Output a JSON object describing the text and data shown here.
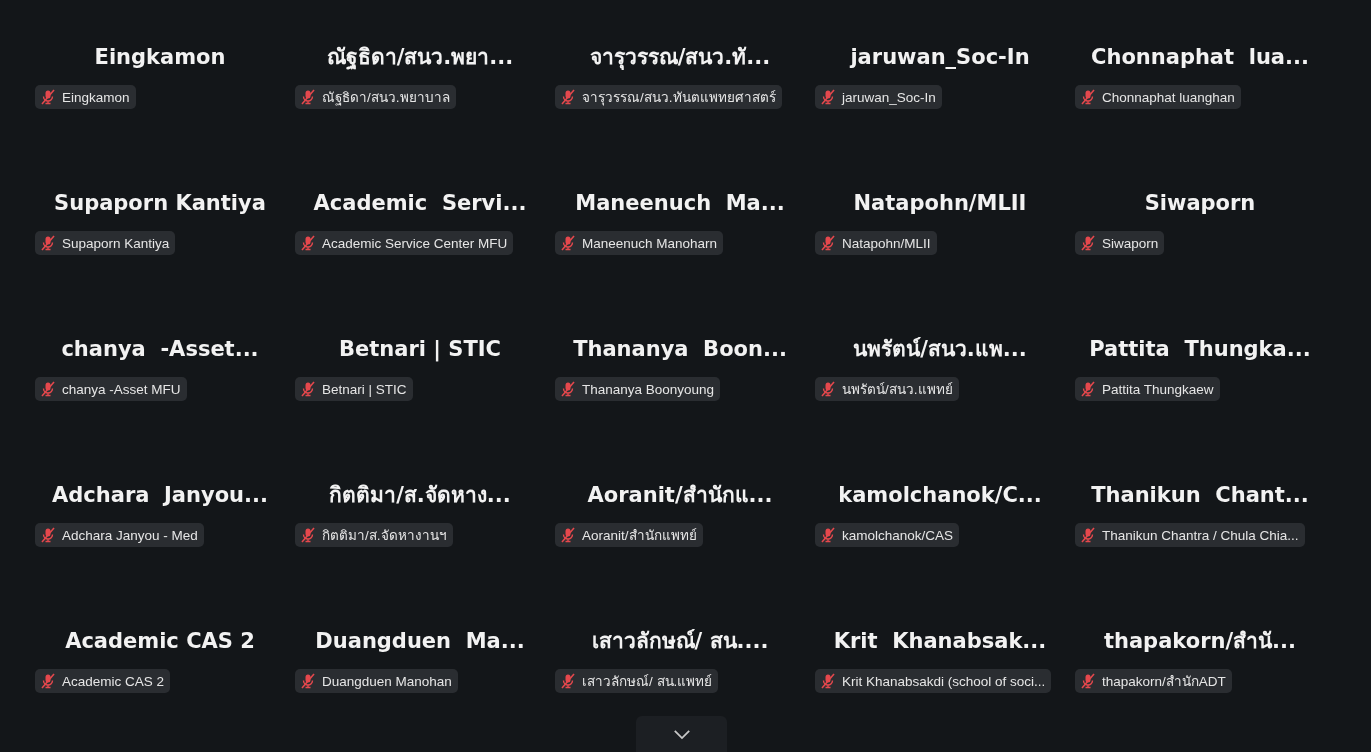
{
  "tiles": [
    {
      "display_name": "Eingkamon",
      "label": "Eingkamon",
      "muted": true
    },
    {
      "display_name": "ณัฐธิดา/สนว.พยา...",
      "label": "ณัฐธิดา/สนว.พยาบาล",
      "muted": true
    },
    {
      "display_name": "จารุวรรณ/สนว.ทั...",
      "label": "จารุวรรณ/สนว.ทันตแพทยศาสตร์",
      "muted": true
    },
    {
      "display_name": "jaruwan_Soc-In",
      "label": "jaruwan_Soc-In",
      "muted": true
    },
    {
      "display_name": "Chonnaphat  lua...",
      "label": "Chonnaphat luanghan",
      "muted": true
    },
    {
      "display_name": "Supaporn Kantiya",
      "label": "Supaporn Kantiya",
      "muted": true
    },
    {
      "display_name": "Academic  Servi...",
      "label": "Academic Service Center MFU",
      "muted": true
    },
    {
      "display_name": "Maneenuch  Ma...",
      "label": "Maneenuch Manoharn",
      "muted": true
    },
    {
      "display_name": "Natapohn/MLII",
      "label": "Natapohn/MLII",
      "muted": true
    },
    {
      "display_name": "Siwaporn",
      "label": "Siwaporn",
      "muted": true
    },
    {
      "display_name": "chanya  -Asset...",
      "label": "chanya -Asset MFU",
      "muted": true
    },
    {
      "display_name": "Betnari | STIC",
      "label": "Betnari | STIC",
      "muted": true
    },
    {
      "display_name": "Thananya  Boon...",
      "label": "Thananya Boonyoung",
      "muted": true
    },
    {
      "display_name": "นพรัตน์/สนว.แพ...",
      "label": "นพรัตน์/สนว.แพทย์",
      "muted": true
    },
    {
      "display_name": "Pattita  Thungka...",
      "label": "Pattita Thungkaew",
      "muted": true
    },
    {
      "display_name": "Adchara  Janyou...",
      "label": "Adchara Janyou - Med",
      "muted": true
    },
    {
      "display_name": "กิตติมา/ส.จัดหาง...",
      "label": "กิตติมา/ส.จัดหางานฯ",
      "muted": true
    },
    {
      "display_name": "Aoranit/สำนักแ...",
      "label": "Aoranit/สำนักแพทย์",
      "muted": true
    },
    {
      "display_name": "kamolchanok/C...",
      "label": "kamolchanok/CAS",
      "muted": true
    },
    {
      "display_name": "Thanikun  Chant...",
      "label": "Thanikun Chantra / Chula Chia...",
      "muted": true
    },
    {
      "display_name": "Academic CAS 2",
      "label": "Academic CAS 2",
      "muted": true
    },
    {
      "display_name": "Duangduen  Ma...",
      "label": "Duangduen Manohan",
      "muted": true
    },
    {
      "display_name": "เสาวลักษณ์/ สน....",
      "label": "เสาวลักษณ์/ สน.แพทย์",
      "muted": true
    },
    {
      "display_name": "Krit  Khanabsak...",
      "label": "Krit Khanabsakdi (school of soci...",
      "muted": true
    },
    {
      "display_name": "thapakorn/สำนั...",
      "label": "thapakorn/สำนักADT",
      "muted": true
    }
  ]
}
